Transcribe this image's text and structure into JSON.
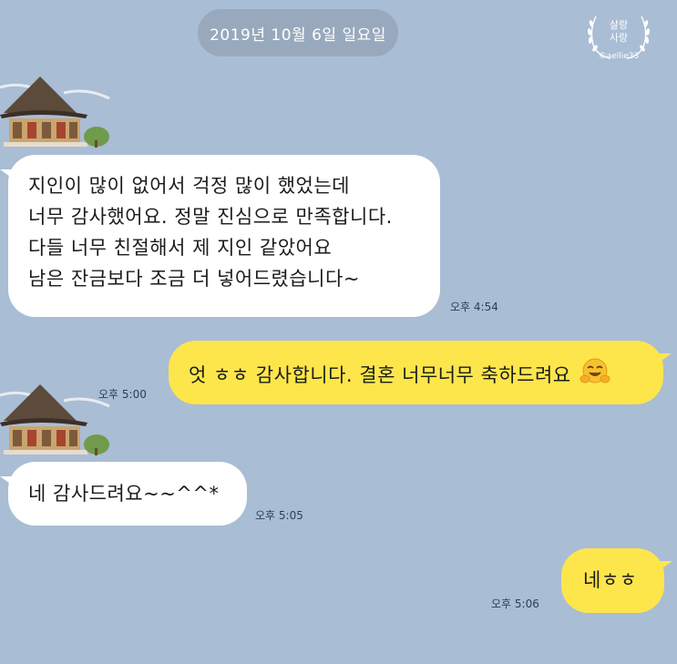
{
  "date_divider": "2019년 10월 6일 일요일",
  "watermark": {
    "line1": "살랑",
    "line2": "사랑",
    "handle": "©aellie33"
  },
  "messages": [
    {
      "direction": "incoming",
      "lines": [
        "지인이 많이 없어서 걱정 많이 했었는데",
        "너무 감사했어요. 정말 진심으로 만족합니다.",
        "다들 너무 친절해서 제 지인 같았어요",
        "남은 잔금보다 조금 더 넣어드렸습니다~"
      ],
      "time": "오후 4:54"
    },
    {
      "direction": "outgoing",
      "text": "엇 ㅎㅎ 감사합니다. 결혼 너무너무 축하드려요",
      "emoji": "hugging-face-emoji",
      "time": "오후 5:00"
    },
    {
      "direction": "incoming",
      "text": "네 감사드려요~~^^*",
      "time": "오후 5:05"
    },
    {
      "direction": "outgoing",
      "text": "네ㅎㅎ",
      "time": "오후 5:06"
    }
  ],
  "colors": {
    "background": "#a9bdd5",
    "date_pill": "#98a9bd",
    "incoming_bubble": "#ffffff",
    "outgoing_bubble": "#fde64b",
    "time_text": "#2e3e55"
  },
  "avatar_icon": "hanok-house-icon"
}
